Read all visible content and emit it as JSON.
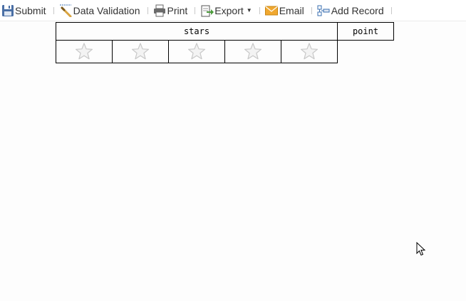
{
  "toolbar": {
    "submit": {
      "label": "Submit",
      "icon": "floppy-disk-icon"
    },
    "data_validation": {
      "label": "Data Validation",
      "icon": "magic-wand-icon"
    },
    "print": {
      "label": "Print",
      "icon": "printer-icon"
    },
    "export": {
      "label": "Export",
      "icon": "export-document-icon"
    },
    "email": {
      "label": "Email",
      "icon": "envelope-icon"
    },
    "add_record": {
      "label": "Add Record",
      "icon": "add-record-icon"
    }
  },
  "table": {
    "header_stars": "stars",
    "header_point": "point",
    "rating": {
      "max": 5,
      "value": 0
    }
  },
  "colors": {
    "star_outline": "#c8c8c8",
    "star_fill": "#f3f3f3",
    "accent_blue": "#3a6fb0",
    "email_orange": "#f0a830"
  }
}
